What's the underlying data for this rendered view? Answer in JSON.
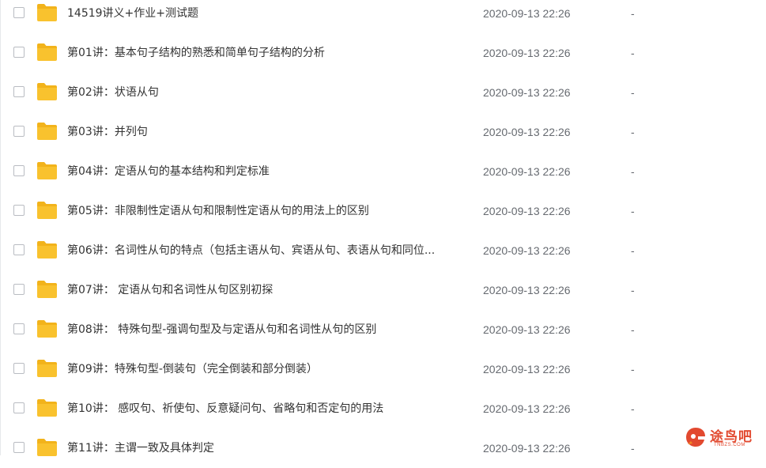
{
  "files": [
    {
      "name": "14519讲义+作业+测试题",
      "modified": "2020-09-13 22:26",
      "size": "-"
    },
    {
      "name": "第01讲：基本句子结构的熟悉和简单句子结构的分析",
      "modified": "2020-09-13 22:26",
      "size": "-"
    },
    {
      "name": "第02讲：状语从句",
      "modified": "2020-09-13 22:26",
      "size": "-"
    },
    {
      "name": "第03讲：并列句",
      "modified": "2020-09-13 22:26",
      "size": "-"
    },
    {
      "name": "第04讲：定语从句的基本结构和判定标准",
      "modified": "2020-09-13 22:26",
      "size": "-"
    },
    {
      "name": "第05讲：非限制性定语从句和限制性定语从句的用法上的区别",
      "modified": "2020-09-13 22:26",
      "size": "-"
    },
    {
      "name": "第06讲：名词性从句的特点（包括主语从句、宾语从句、表语从句和同位...",
      "modified": "2020-09-13 22:26",
      "size": "-"
    },
    {
      "name": "第07讲： 定语从句和名词性从句区别初探",
      "modified": "2020-09-13 22:26",
      "size": "-"
    },
    {
      "name": "第08讲： 特殊句型-强调句型及与定语从句和名词性从句的区别",
      "modified": "2020-09-13 22:26",
      "size": "-"
    },
    {
      "name": "第09讲：特殊句型-倒装句（完全倒装和部分倒装）",
      "modified": "2020-09-13 22:26",
      "size": "-"
    },
    {
      "name": "第10讲： 感叹句、祈使句、反意疑问句、省略句和否定句的用法",
      "modified": "2020-09-13 22:26",
      "size": "-"
    },
    {
      "name": "第11讲：主谓一致及具体判定",
      "modified": "2020-09-13 22:26",
      "size": "-"
    }
  ],
  "icons": {
    "row_checkbox": "checkbox-icon",
    "row_folder": "folder-icon"
  },
  "colors": {
    "folder": "#f9c22e",
    "folder_tab": "#f2b31b",
    "text": "#333333",
    "meta_text": "#666a70",
    "watermark": "#e2492f"
  },
  "watermark": {
    "text": "途鸟吧",
    "domain": "TNBZS.COM"
  }
}
